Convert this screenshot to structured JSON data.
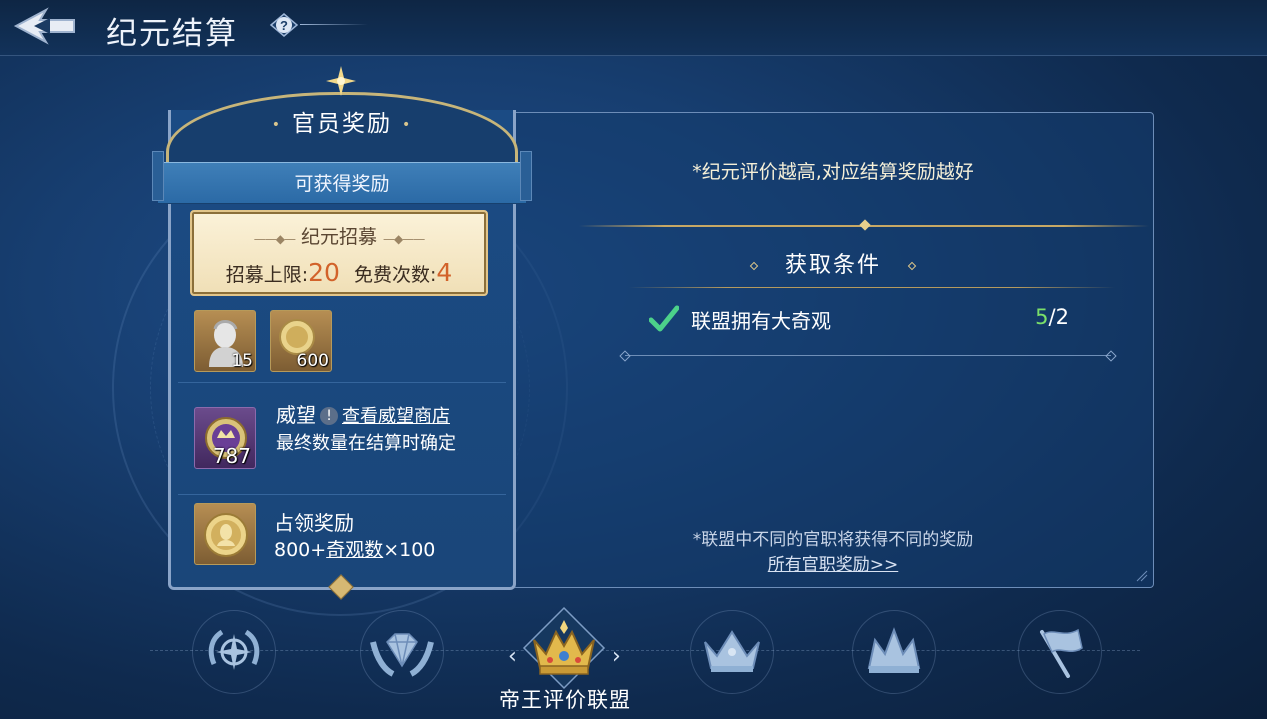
{
  "header": {
    "title": "纪元结算",
    "help_icon": "question-icon",
    "back_icon": "back-arrow-icon"
  },
  "reward_card": {
    "title": "官员奖励",
    "ribbon_label": "可获得奖励",
    "recruit": {
      "title": "纪元招募",
      "limit_label": "招募上限:",
      "limit_value": "20",
      "free_label": "免费次数:",
      "free_value": "4"
    },
    "items": [
      {
        "icon": "bust-statue-icon",
        "count": "15"
      },
      {
        "icon": "gold-coin-icon",
        "count": "600"
      }
    ],
    "prestige": {
      "icon": "prestige-medal-icon",
      "count": "787",
      "title": "威望",
      "link": "查看威望商店",
      "note": "最终数量在结算时确定"
    },
    "occupation": {
      "icon": "gold-medallion-icon",
      "title": "占领奖励",
      "formula_prefix": "800+",
      "formula_link": "奇观数",
      "formula_suffix": "×100"
    }
  },
  "info_panel": {
    "rating_note": "*纪元评价越高,对应结算奖励越好",
    "conditions_title": "获取条件",
    "conditions": [
      {
        "text": "联盟拥有大奇观",
        "current": "5",
        "separator": "/",
        "target": "2",
        "done": true
      }
    ],
    "office_note": "*联盟中不同的官职将获得不同的奖励",
    "office_link": "所有官职奖励>>"
  },
  "tabs": [
    {
      "icon": "compass-laurel-icon",
      "active": false
    },
    {
      "icon": "diamond-wings-icon",
      "active": false
    },
    {
      "icon": "gold-crown-icon",
      "active": true,
      "label": "帝王评价联盟"
    },
    {
      "icon": "silver-crown-icon",
      "active": false
    },
    {
      "icon": "pointed-crown-icon",
      "active": false
    },
    {
      "icon": "flag-icon",
      "active": false
    }
  ],
  "colors": {
    "accent_gold": "#c7a865",
    "progress_green": "#7be06a",
    "recruit_number": "#d2622a",
    "background": "#173e70"
  }
}
